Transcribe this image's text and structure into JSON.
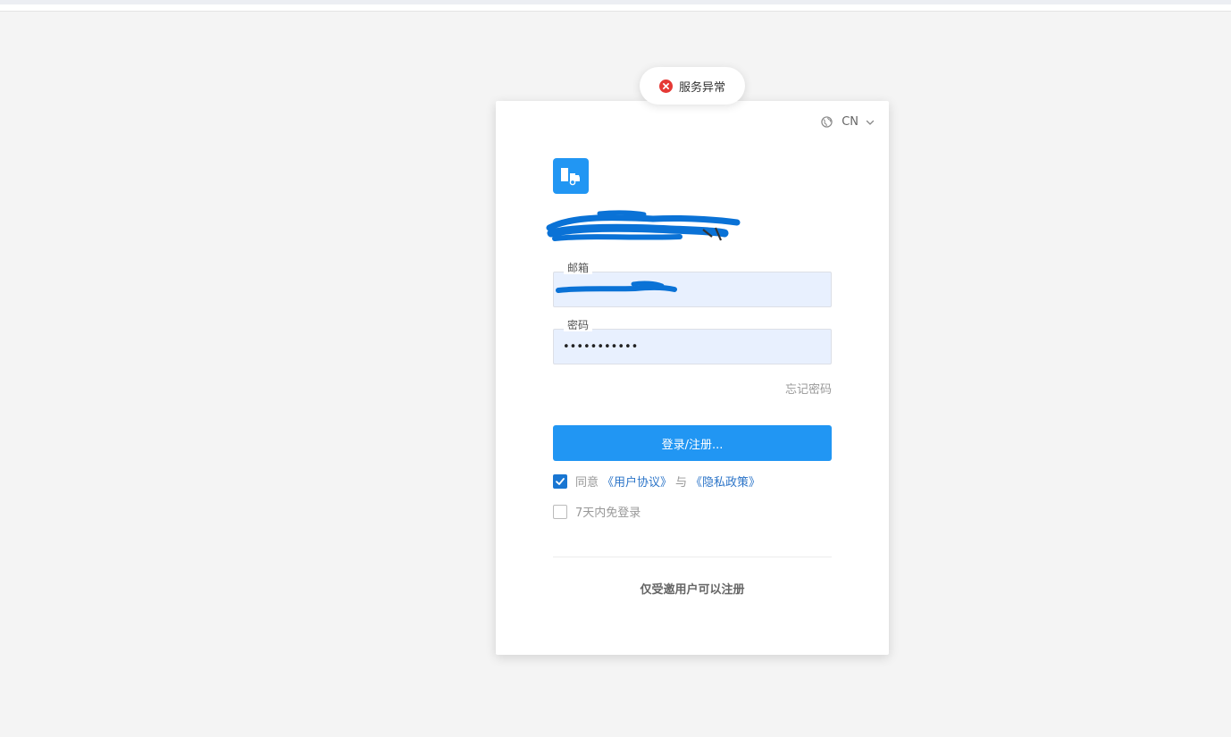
{
  "toast": {
    "message": "服务异常",
    "status_color": "#e53935"
  },
  "header": {
    "language_label": "CN"
  },
  "brand": {
    "accent_color": "#2196f3",
    "logo_icon": "truck-icon"
  },
  "form": {
    "email_label": "邮箱",
    "password_label": "密码",
    "password_value": "•••••••••••",
    "forgot_label": "忘记密码",
    "submit_label": "登录/注册..."
  },
  "agreement": {
    "agree_prefix": "同意",
    "user_agreement": "《用户协议》",
    "conjunction": "与",
    "privacy_policy": "《隐私政策》"
  },
  "remember": {
    "label": "7天内免登录"
  },
  "footer": {
    "invite_note": "仅受邀用户可以注册"
  }
}
